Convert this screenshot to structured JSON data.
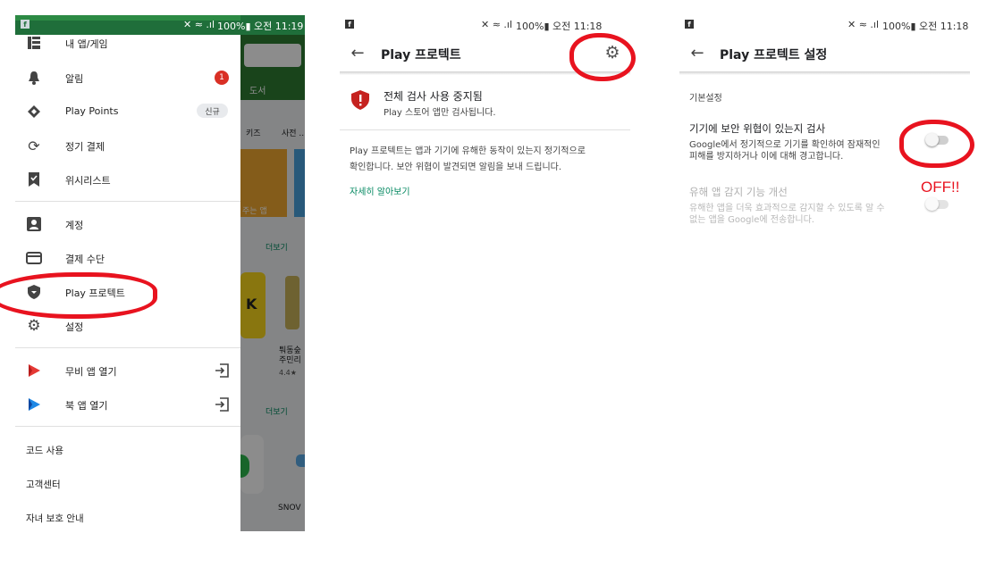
{
  "status_bar_1": {
    "icon": "facebook-icon",
    "text": "100%▮ 오전 11:19"
  },
  "status_bar_2": {
    "icon": "facebook-icon",
    "text": "100%▮ 오전 11:18"
  },
  "status_bar_3": {
    "icon": "facebook-icon",
    "text": "100%▮ 오전 11:18"
  },
  "drawer": {
    "items": [
      {
        "label": "내 앱/게임",
        "icon": "apps-grid-icon"
      },
      {
        "label": "알림",
        "icon": "bell-icon",
        "badge": "1"
      },
      {
        "label": "Play Points",
        "icon": "diamond-icon",
        "tag": "신규"
      },
      {
        "label": "정기 결제",
        "icon": "refresh-icon"
      },
      {
        "label": "위시리스트",
        "icon": "bookmark-check-icon"
      },
      {
        "label": "계정",
        "icon": "account-box-icon"
      },
      {
        "label": "결제 수단",
        "icon": "credit-card-icon"
      },
      {
        "label": "Play 프로텍트",
        "icon": "shield-icon"
      },
      {
        "label": "설정",
        "icon": "gear-icon"
      },
      {
        "label": "무비 앱 열기",
        "icon": "play-movies-icon"
      },
      {
        "label": "북 앱 열기",
        "icon": "play-books-icon"
      }
    ],
    "footer": [
      "코드 사용",
      "고객센터",
      "자녀 보호 안내"
    ]
  },
  "background_app": {
    "tab": "도서",
    "cats": [
      "키즈",
      "사전 ..."
    ],
    "banner_text": "주는 앱",
    "more1": "더보기",
    "more2": "더보기",
    "app_name": "퉈동숲\n주민리",
    "rating": "4.4★",
    "snow": "SNOV"
  },
  "protect": {
    "title": "Play 프로텍트",
    "status_title": "전체 검사 사용 중지됨",
    "status_sub": "Play 스토어 앱만 검사됩니다.",
    "desc1": "Play 프로텍트는 앱과 기기에 유해한 동작이 있는지 정기적으로",
    "desc2": "확인합니다. 보안 위협이 발견되면 알림을 보내 드립니다.",
    "learn_more": "자세히 알아보기"
  },
  "settings": {
    "title": "Play 프로텍트 설정",
    "section": "기본설정",
    "opt1_title": "기기에 보안 위협이 있는지 검사",
    "opt1_d1": "Google에서 정기적으로 기기를 확인하여 잠재적인",
    "opt1_d2": "피해를 방지하거나 이에 대해 경고합니다.",
    "opt2_title": "유해 앱 감지 기능 개선",
    "opt2_d1": "유해한 앱을 더욱 효과적으로 감지할 수 있도록 알 수",
    "opt2_d2": "없는 앱을 Google에 전송합니다.",
    "annotation": "OFF!!"
  },
  "colors": {
    "accent": "#01875f",
    "annotation": "#e8131f",
    "badge": "#d93025"
  }
}
